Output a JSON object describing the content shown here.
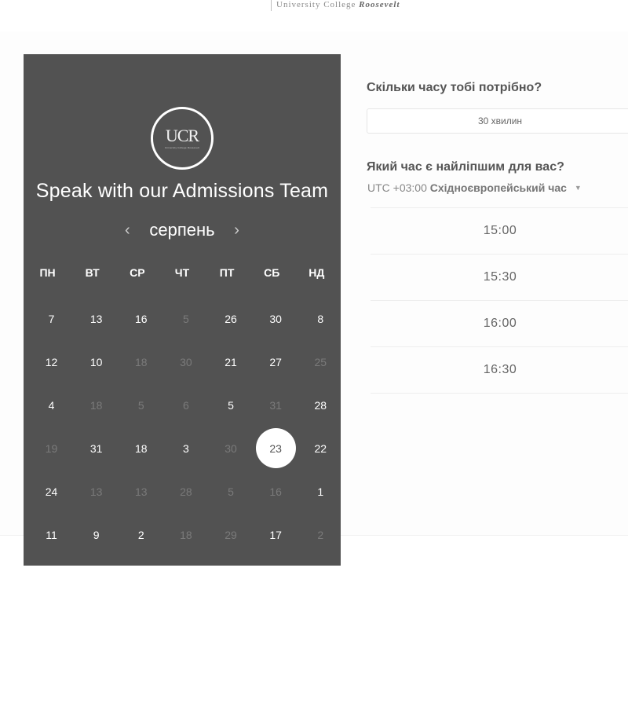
{
  "brand": {
    "line1": "University College",
    "line2": "Roosevelt"
  },
  "calendar": {
    "logo_text": "UCR",
    "logo_subtext": "University College Roosevelt",
    "title": "Speak with our Admissions Team",
    "month": "серпень",
    "prev_symbol": "‹",
    "next_symbol": "›",
    "weekdays": [
      "ПН",
      "ВТ",
      "СР",
      "ЧТ",
      "ПТ",
      "СБ",
      "НД"
    ],
    "weeks": [
      [
        {
          "d": "7",
          "a": true
        },
        {
          "d": "13",
          "a": true
        },
        {
          "d": "16",
          "a": true
        },
        {
          "d": "5",
          "a": false
        },
        {
          "d": "26",
          "a": true
        },
        {
          "d": "30",
          "a": true
        },
        {
          "d": "8",
          "a": true
        }
      ],
      [
        {
          "d": "12",
          "a": true
        },
        {
          "d": "10",
          "a": true
        },
        {
          "d": "18",
          "a": false
        },
        {
          "d": "30",
          "a": false
        },
        {
          "d": "21",
          "a": true
        },
        {
          "d": "27",
          "a": true
        },
        {
          "d": "25",
          "a": false
        }
      ],
      [
        {
          "d": "4",
          "a": true
        },
        {
          "d": "18",
          "a": false
        },
        {
          "d": "5",
          "a": false
        },
        {
          "d": "6",
          "a": false
        },
        {
          "d": "5",
          "a": true
        },
        {
          "d": "31",
          "a": false
        },
        {
          "d": "28",
          "a": true
        }
      ],
      [
        {
          "d": "19",
          "a": false
        },
        {
          "d": "31",
          "a": true
        },
        {
          "d": "18",
          "a": true
        },
        {
          "d": "3",
          "a": true
        },
        {
          "d": "30",
          "a": false
        },
        {
          "d": "23",
          "a": true,
          "selected": true
        },
        {
          "d": "22",
          "a": true
        }
      ],
      [
        {
          "d": "24",
          "a": true
        },
        {
          "d": "13",
          "a": false
        },
        {
          "d": "13",
          "a": false
        },
        {
          "d": "28",
          "a": false
        },
        {
          "d": "5",
          "a": false
        },
        {
          "d": "16",
          "a": false
        },
        {
          "d": "1",
          "a": true
        }
      ],
      [
        {
          "d": "11",
          "a": true
        },
        {
          "d": "9",
          "a": true
        },
        {
          "d": "2",
          "a": true
        },
        {
          "d": "18",
          "a": false
        },
        {
          "d": "29",
          "a": false
        },
        {
          "d": "17",
          "a": true
        },
        {
          "d": "2",
          "a": false
        }
      ]
    ]
  },
  "booking": {
    "duration_question": "Скільки часу тобі потрібно?",
    "duration_value": "30 хвилин",
    "time_question": "Який час є найліпшим для вас?",
    "timezone_offset": "UTC +03:00",
    "timezone_name": "Східноєвропейський час",
    "timezone_caret": "▼",
    "slots": [
      "15:00",
      "15:30",
      "16:00",
      "16:30"
    ]
  },
  "colors": {
    "panel_bg": "#525252",
    "muted_day": "#7a7a7a",
    "text": "#555555"
  }
}
